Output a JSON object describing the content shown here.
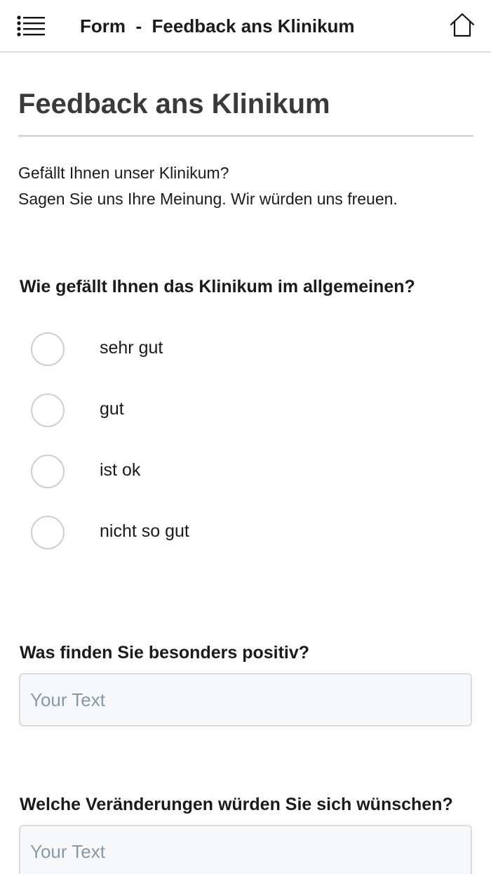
{
  "topbar": {
    "title": "Form  -  Feedback ans Klinikum",
    "menu_icon": "menu-list-icon",
    "home_icon": "home-icon"
  },
  "page": {
    "title": "Feedback ans Klinikum",
    "intro_line1": "Gefällt Ihnen unser Klinikum?",
    "intro_line2": "Sagen Sie uns Ihre Meinung. Wir würden uns freuen."
  },
  "question1": {
    "label": "Wie gefällt Ihnen das Klinikum im allgemeinen?",
    "options": [
      "sehr gut",
      "gut",
      "ist ok",
      "nicht so gut"
    ],
    "selected": null
  },
  "question2": {
    "label": "Was finden Sie besonders positiv?",
    "value": "",
    "placeholder": "Your Text"
  },
  "question3": {
    "label": "Welche Veränderungen würden Sie sich wünschen?",
    "value": "",
    "placeholder": "Your Text"
  },
  "colors": {
    "title": "#3a3a3a",
    "text": "#1b1b1b",
    "rule": "#d9d9d9",
    "radio_border": "#cfcfcf",
    "input_bg": "#f6f8fa",
    "placeholder": "#8a9aa5"
  }
}
